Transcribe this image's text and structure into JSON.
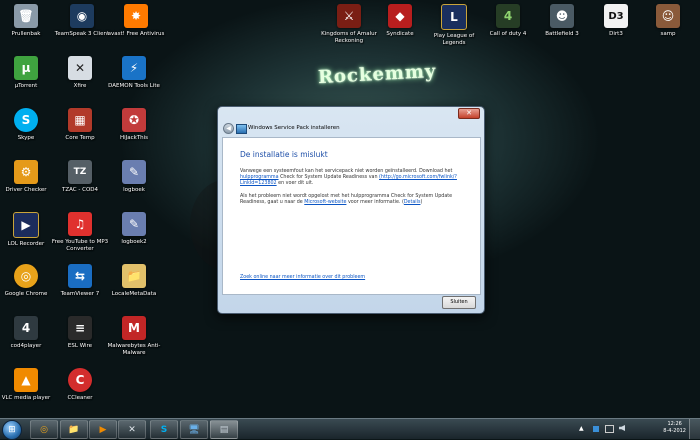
{
  "desktop": {
    "wallpaper_text": "Rockemmy",
    "icons": [
      {
        "label": "Prullenbak",
        "glyph": "🗑",
        "color": "#8a9aa8"
      },
      {
        "label": "TeamSpeak 3 Client",
        "glyph": "◉",
        "color": "#1d3b5e"
      },
      {
        "label": "avast! Free Antivirus",
        "glyph": "✸",
        "color": "#ff7a00"
      },
      {
        "label": "μTorrent",
        "glyph": "µ",
        "color": "#3fa33f"
      },
      {
        "label": "Xfire",
        "glyph": "✕",
        "color": "#d7dde3"
      },
      {
        "label": "DAEMON Tools Lite",
        "glyph": "⚡",
        "color": "#1a73c7"
      },
      {
        "label": "Skype",
        "glyph": "S",
        "color": "#00aff0"
      },
      {
        "label": "Core Temp",
        "glyph": "▦",
        "color": "#b23a2a"
      },
      {
        "label": "HiJackThis",
        "glyph": "✪",
        "color": "#c23b3b"
      },
      {
        "label": "Driver Checker",
        "glyph": "⚙",
        "color": "#e59a1a"
      },
      {
        "label": "TZAC - COD4",
        "glyph": "TZ",
        "color": "#555f66"
      },
      {
        "label": "logboek",
        "glyph": "✎",
        "color": "#6a7eb0"
      },
      {
        "label": "LOL Recorder",
        "glyph": "▶",
        "color": "#1b2c5c"
      },
      {
        "label": "Free YouTube to MP3 Converter",
        "glyph": "♫",
        "color": "#e0312e"
      },
      {
        "label": "logboek2",
        "glyph": "✎",
        "color": "#6a7eb0"
      },
      {
        "label": "Google Chrome",
        "glyph": "◎",
        "color": "#e8a21a"
      },
      {
        "label": "TeamViewer 7",
        "glyph": "⇆",
        "color": "#1a6dc2"
      },
      {
        "label": "LocaleMetaData",
        "glyph": "📁",
        "color": "#e1c06a"
      },
      {
        "label": "cod4player",
        "glyph": "4",
        "color": "#2f3a40"
      },
      {
        "label": "ESL Wire",
        "glyph": "≡",
        "color": "#2a2a2a"
      },
      {
        "label": "Malwarebytes Anti-Malware",
        "glyph": "M",
        "color": "#c22626"
      },
      {
        "label": "VLC media player",
        "glyph": "▲",
        "color": "#f08a00"
      },
      {
        "label": "CCleaner",
        "glyph": "C",
        "color": "#d32d2d"
      },
      {
        "label": "Kingdoms of Amalur Reckoning",
        "glyph": "⚔",
        "color": "#7a1e14"
      },
      {
        "label": "Syndicate",
        "glyph": "◆",
        "color": "#b81e1e"
      },
      {
        "label": "Play League of Legends",
        "glyph": "L",
        "color": "#1a2f5e"
      },
      {
        "label": "Call of duty 4",
        "glyph": "4",
        "color": "#263d25"
      },
      {
        "label": "Battlefield 3",
        "glyph": "☻",
        "color": "#4a5a64"
      },
      {
        "label": "Dirt3",
        "glyph": "D3",
        "color": "#f2f2f2"
      },
      {
        "label": "samp",
        "glyph": "☺",
        "color": "#8a5a3a"
      }
    ]
  },
  "dialog": {
    "title": "Windows Service Pack installeren",
    "close_glyph": "✕",
    "back_glyph": "◀",
    "heading": "De installatie is mislukt",
    "p1_text": "Vanwege een systeemfout kan het servicepack niet worden geïnstalleerd. Download het",
    "p1_link1": "hulpprogramma",
    "p1_mid": "Check for System Update Readiness van",
    "p1_link2": "(http://go.microsoft.com/fwlink/?LinkId=123802",
    "p1_end": "en voer dit uit.",
    "p2_text": "Als het probleem niet wordt opgelost met het hulpprogramma Check for System Update Readiness, gaat u naar de",
    "p2_link1": "Microsoft-website",
    "p2_mid": "voor meer informatie. (",
    "p2_link2": "Details",
    "p2_end": ")",
    "more_info_link": "Zoek online naar meer informatie over dit probleem",
    "close_button": "Sluiten"
  },
  "taskbar": {
    "start_glyph": "⊞",
    "buttons": [
      {
        "name": "chrome",
        "glyph": "◎",
        "color": "#e8a21a"
      },
      {
        "name": "explorer",
        "glyph": "📁",
        "color": "#e1c06a"
      },
      {
        "name": "media-player",
        "glyph": "▶",
        "color": "#f08a00"
      },
      {
        "name": "xfire",
        "glyph": "✕",
        "color": "#e0e6ec"
      },
      {
        "name": "skype",
        "glyph": "S",
        "color": "#00aff0"
      },
      {
        "name": "remote-desktop",
        "glyph": "🖥",
        "color": "#6ab0e8"
      },
      {
        "name": "windows-update",
        "glyph": "▤",
        "color": "#c9d2da"
      }
    ],
    "tray": {
      "show_hidden_glyph": "▲",
      "time": "12:26",
      "date": "8-4-2012"
    }
  }
}
